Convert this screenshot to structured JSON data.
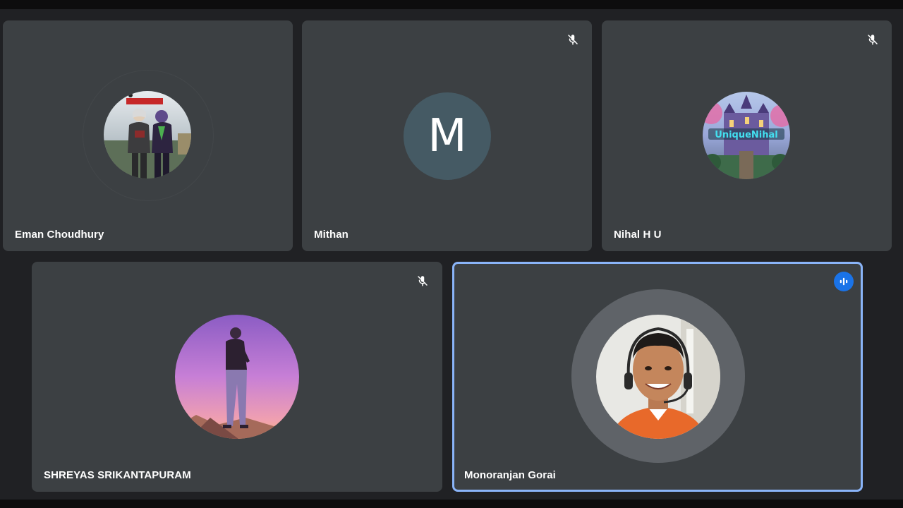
{
  "participants": [
    {
      "name": "Eman Choudhury",
      "muted": false,
      "avatar": "game-characters-image"
    },
    {
      "name": "Mithan",
      "muted": true,
      "avatar_letter": "M",
      "avatar_color": "#455a64"
    },
    {
      "name": "Nihal H U",
      "muted": true,
      "avatar": "castle-uniquenihal-image",
      "avatar_text": "UniqueNihal"
    },
    {
      "name": "SHREYAS SRIKANTAPURAM",
      "muted": true,
      "avatar": "silhouette-sunset-image"
    },
    {
      "name": "Monoranjan Gorai",
      "muted": false,
      "speaking": true,
      "avatar": "person-headset-photo"
    }
  ],
  "colors": {
    "background": "#202124",
    "tile": "#3c4043",
    "speaking_border": "#8ab4f8",
    "speaking_indicator": "#1a73e8"
  },
  "icons": {
    "muted": "mic-off-icon",
    "speaking": "audio-level-icon"
  }
}
